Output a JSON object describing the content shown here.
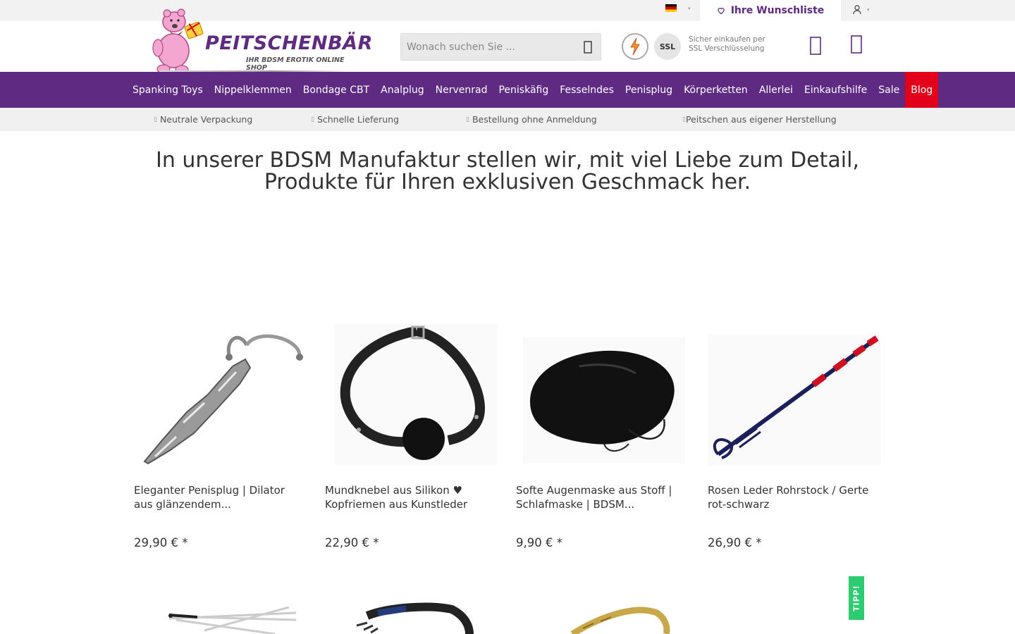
{
  "topbar": {
    "wishlist_label": "Ihre Wunschliste"
  },
  "header": {
    "logo_title": "PEITSCHENBÄR",
    "logo_subtitle": "IHR BDSM EROTIK ONLINE SHOP",
    "search_placeholder": "Wonach suchen Sie ...",
    "ssl_badge": "SSL",
    "ssl_text_line1": "Sicher einkaufen per",
    "ssl_text_line2": "SSL Verschlüsselung"
  },
  "nav": {
    "items": [
      {
        "label": "Spanking Toys"
      },
      {
        "label": "Nippelklemmen"
      },
      {
        "label": "Bondage CBT"
      },
      {
        "label": "Analplug"
      },
      {
        "label": "Nervenrad"
      },
      {
        "label": "Peniskäfig"
      },
      {
        "label": "Fesselndes"
      },
      {
        "label": "Penisplug"
      },
      {
        "label": "Körperketten"
      },
      {
        "label": "Allerlei"
      },
      {
        "label": "Einkaufshilfe"
      },
      {
        "label": "Sale"
      },
      {
        "label": "Blog"
      }
    ]
  },
  "usp": {
    "items": [
      {
        "label": "Neutrale Verpackung"
      },
      {
        "label": "Schnelle Lieferung"
      },
      {
        "label": "Bestellung ohne Anmeldung"
      },
      {
        "label": "Peitschen aus eigener Herstellung"
      }
    ]
  },
  "headline": "In unserer BDSM Manufaktur stellen wir, mit viel Liebe zum Detail, Produkte für Ihren exklusiven Geschmack her.",
  "products": [
    {
      "title": "Eleganter Penisplug  |  Dilator aus glänzendem...",
      "price": "29,90 € *"
    },
    {
      "title": "Mundknebel aus Silikon ♥ Kopfriemen aus Kunstleder",
      "price": "22,90 € *"
    },
    {
      "title": "Softe Augenmaske aus Stoff  |  Schlafmaske  |  BDSM...",
      "price": "9,90 € *"
    },
    {
      "title": "Rosen Leder Rohrstock / Gerte rot-schwarz",
      "price": "26,90 € *"
    }
  ],
  "tipp_label": "TIPP!",
  "colors": {
    "brand_purple": "#5f2a82",
    "blog_red": "#e3001b",
    "tipp_green": "#2ecc71"
  },
  "icons": [
    "flag-de-icon",
    "caret-down-icon",
    "heart-icon",
    "user-icon",
    "search-icon",
    "bolt-icon",
    "cart-icon",
    "check-icon"
  ]
}
